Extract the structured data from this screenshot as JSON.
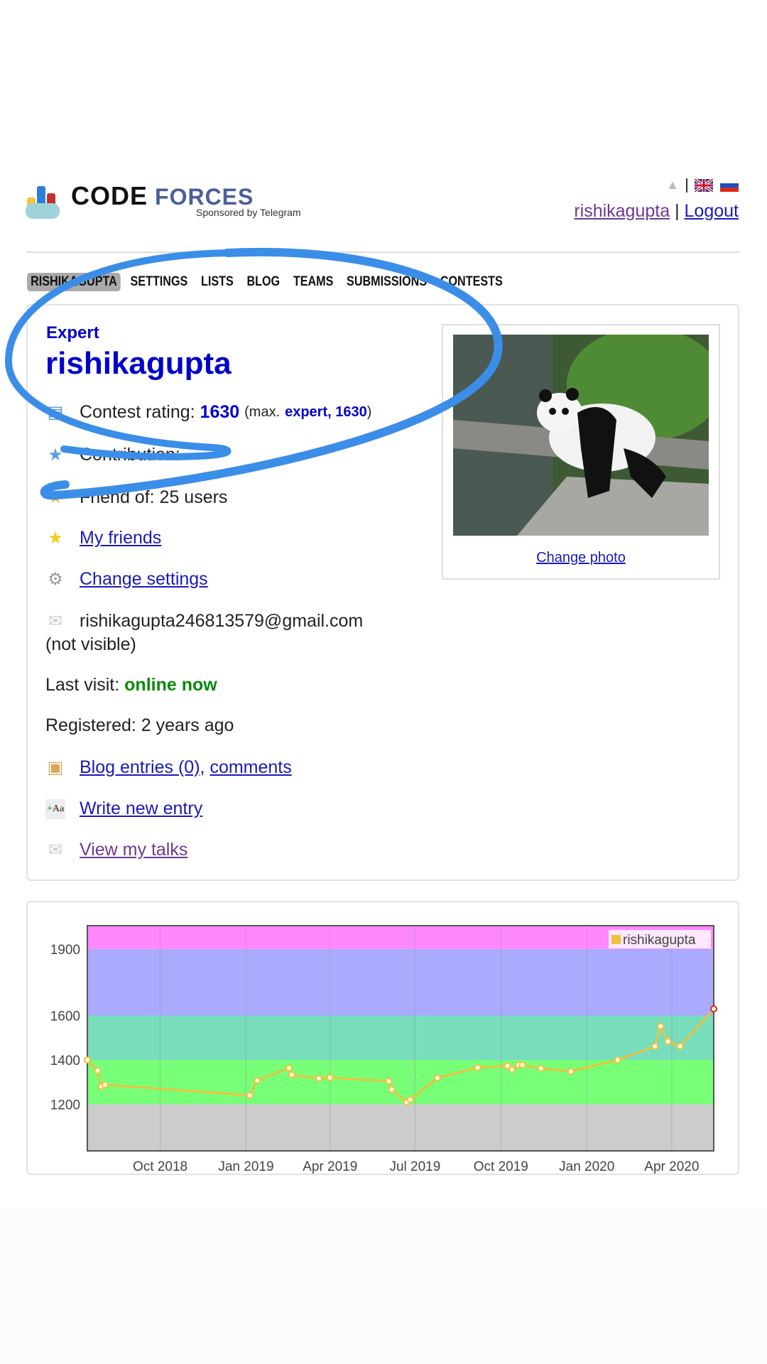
{
  "header": {
    "logo_code": "CODE",
    "logo_forces": "FORCES",
    "sponsor": "Sponsored by Telegram",
    "user_link": "rishikagupta",
    "separator": "|",
    "logout": "Logout"
  },
  "nav": [
    "RISHIKAGUPTA",
    "SETTINGS",
    "LISTS",
    "BLOG",
    "TEAMS",
    "SUBMISSIONS",
    "CONTESTS"
  ],
  "profile": {
    "rank": "Expert",
    "handle": "rishikagupta",
    "rating_label": "Contest rating:",
    "rating": "1630",
    "max_prefix": "(max.",
    "max_value": "expert, 1630",
    "max_suffix": ")",
    "contribution_label": "Contribution:",
    "friend_of": "Friend of: 25 users",
    "my_friends": "My friends",
    "change_settings": "Change settings",
    "email": "rishikagupta246813579@gmail.com",
    "email_note": "(not visible)",
    "last_visit_label": "Last visit:",
    "last_visit": "online now",
    "registered": "Registered: 2 years ago",
    "blog_entries": "Blog entries (0)",
    "comma": ",",
    "comments": "comments",
    "write_entry": "Write new entry",
    "view_talks": "View my talks",
    "change_photo": "Change photo"
  },
  "colors": {
    "handle": "#0000cc",
    "online": "#0a8a0a",
    "link": "#1a1ab8",
    "annotation": "#3b8ee8"
  },
  "chart_data": {
    "type": "line",
    "legend": [
      "rishikagupta"
    ],
    "legend_position": "top-right",
    "x_tick_labels": [
      "Oct 2018",
      "Jan 2019",
      "Apr 2019",
      "Jul 2019",
      "Oct 2019",
      "Jan 2020",
      "Apr 2020"
    ],
    "x_ticks": [
      "2018-10-01",
      "2019-01-01",
      "2019-04-01",
      "2019-07-01",
      "2019-10-01",
      "2020-01-01",
      "2020-04-01"
    ],
    "y_tick_labels": [
      1200,
      1400,
      1600,
      1900
    ],
    "xlim": [
      "2018-07-15",
      "2020-05-16"
    ],
    "ylim": [
      990,
      2005
    ],
    "grid": true,
    "bands": [
      {
        "from": 990,
        "to": 1200,
        "color": "#cccccc"
      },
      {
        "from": 1200,
        "to": 1400,
        "color": "#77ff77"
      },
      {
        "from": 1400,
        "to": 1600,
        "color": "#77ddbb"
      },
      {
        "from": 1600,
        "to": 1900,
        "color": "#aaaaff"
      },
      {
        "from": 1900,
        "to": 2005,
        "color": "#ff88ff"
      }
    ],
    "series": [
      {
        "name": "rishikagupta",
        "color": "#edc240",
        "points": [
          [
            "2018-07-15",
            1400
          ],
          [
            "2018-07-26",
            1352
          ],
          [
            "2018-07-30",
            1280
          ],
          [
            "2018-08-03",
            1288
          ],
          [
            "2019-01-05",
            1240
          ],
          [
            "2019-01-13",
            1307
          ],
          [
            "2019-02-16",
            1363
          ],
          [
            "2019-02-19",
            1333
          ],
          [
            "2019-03-20",
            1316
          ],
          [
            "2019-04-01",
            1320
          ],
          [
            "2019-06-03",
            1304
          ],
          [
            "2019-06-06",
            1267
          ],
          [
            "2019-06-22",
            1209
          ],
          [
            "2019-06-26",
            1221
          ],
          [
            "2019-07-25",
            1319
          ],
          [
            "2019-09-06",
            1365
          ],
          [
            "2019-10-08",
            1373
          ],
          [
            "2019-10-13",
            1357
          ],
          [
            "2019-10-20",
            1378
          ],
          [
            "2019-10-24",
            1377
          ],
          [
            "2019-11-13",
            1362
          ],
          [
            "2019-12-15",
            1348
          ],
          [
            "2020-02-03",
            1400
          ],
          [
            "2020-03-14",
            1461
          ],
          [
            "2020-03-20",
            1552
          ],
          [
            "2020-03-28",
            1483
          ],
          [
            "2020-04-10",
            1461
          ],
          [
            "2020-05-16",
            1630
          ]
        ]
      }
    ]
  }
}
